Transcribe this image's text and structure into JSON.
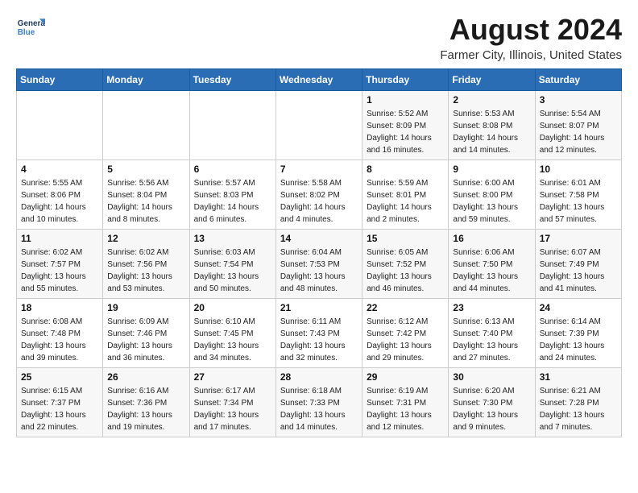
{
  "logo": {
    "line1": "General",
    "line2": "Blue"
  },
  "title": "August 2024",
  "location": "Farmer City, Illinois, United States",
  "days_of_week": [
    "Sunday",
    "Monday",
    "Tuesday",
    "Wednesday",
    "Thursday",
    "Friday",
    "Saturday"
  ],
  "weeks": [
    [
      {
        "day": "",
        "info": ""
      },
      {
        "day": "",
        "info": ""
      },
      {
        "day": "",
        "info": ""
      },
      {
        "day": "",
        "info": ""
      },
      {
        "day": "1",
        "info": "Sunrise: 5:52 AM\nSunset: 8:09 PM\nDaylight: 14 hours\nand 16 minutes."
      },
      {
        "day": "2",
        "info": "Sunrise: 5:53 AM\nSunset: 8:08 PM\nDaylight: 14 hours\nand 14 minutes."
      },
      {
        "day": "3",
        "info": "Sunrise: 5:54 AM\nSunset: 8:07 PM\nDaylight: 14 hours\nand 12 minutes."
      }
    ],
    [
      {
        "day": "4",
        "info": "Sunrise: 5:55 AM\nSunset: 8:06 PM\nDaylight: 14 hours\nand 10 minutes."
      },
      {
        "day": "5",
        "info": "Sunrise: 5:56 AM\nSunset: 8:04 PM\nDaylight: 14 hours\nand 8 minutes."
      },
      {
        "day": "6",
        "info": "Sunrise: 5:57 AM\nSunset: 8:03 PM\nDaylight: 14 hours\nand 6 minutes."
      },
      {
        "day": "7",
        "info": "Sunrise: 5:58 AM\nSunset: 8:02 PM\nDaylight: 14 hours\nand 4 minutes."
      },
      {
        "day": "8",
        "info": "Sunrise: 5:59 AM\nSunset: 8:01 PM\nDaylight: 14 hours\nand 2 minutes."
      },
      {
        "day": "9",
        "info": "Sunrise: 6:00 AM\nSunset: 8:00 PM\nDaylight: 13 hours\nand 59 minutes."
      },
      {
        "day": "10",
        "info": "Sunrise: 6:01 AM\nSunset: 7:58 PM\nDaylight: 13 hours\nand 57 minutes."
      }
    ],
    [
      {
        "day": "11",
        "info": "Sunrise: 6:02 AM\nSunset: 7:57 PM\nDaylight: 13 hours\nand 55 minutes."
      },
      {
        "day": "12",
        "info": "Sunrise: 6:02 AM\nSunset: 7:56 PM\nDaylight: 13 hours\nand 53 minutes."
      },
      {
        "day": "13",
        "info": "Sunrise: 6:03 AM\nSunset: 7:54 PM\nDaylight: 13 hours\nand 50 minutes."
      },
      {
        "day": "14",
        "info": "Sunrise: 6:04 AM\nSunset: 7:53 PM\nDaylight: 13 hours\nand 48 minutes."
      },
      {
        "day": "15",
        "info": "Sunrise: 6:05 AM\nSunset: 7:52 PM\nDaylight: 13 hours\nand 46 minutes."
      },
      {
        "day": "16",
        "info": "Sunrise: 6:06 AM\nSunset: 7:50 PM\nDaylight: 13 hours\nand 44 minutes."
      },
      {
        "day": "17",
        "info": "Sunrise: 6:07 AM\nSunset: 7:49 PM\nDaylight: 13 hours\nand 41 minutes."
      }
    ],
    [
      {
        "day": "18",
        "info": "Sunrise: 6:08 AM\nSunset: 7:48 PM\nDaylight: 13 hours\nand 39 minutes."
      },
      {
        "day": "19",
        "info": "Sunrise: 6:09 AM\nSunset: 7:46 PM\nDaylight: 13 hours\nand 36 minutes."
      },
      {
        "day": "20",
        "info": "Sunrise: 6:10 AM\nSunset: 7:45 PM\nDaylight: 13 hours\nand 34 minutes."
      },
      {
        "day": "21",
        "info": "Sunrise: 6:11 AM\nSunset: 7:43 PM\nDaylight: 13 hours\nand 32 minutes."
      },
      {
        "day": "22",
        "info": "Sunrise: 6:12 AM\nSunset: 7:42 PM\nDaylight: 13 hours\nand 29 minutes."
      },
      {
        "day": "23",
        "info": "Sunrise: 6:13 AM\nSunset: 7:40 PM\nDaylight: 13 hours\nand 27 minutes."
      },
      {
        "day": "24",
        "info": "Sunrise: 6:14 AM\nSunset: 7:39 PM\nDaylight: 13 hours\nand 24 minutes."
      }
    ],
    [
      {
        "day": "25",
        "info": "Sunrise: 6:15 AM\nSunset: 7:37 PM\nDaylight: 13 hours\nand 22 minutes."
      },
      {
        "day": "26",
        "info": "Sunrise: 6:16 AM\nSunset: 7:36 PM\nDaylight: 13 hours\nand 19 minutes."
      },
      {
        "day": "27",
        "info": "Sunrise: 6:17 AM\nSunset: 7:34 PM\nDaylight: 13 hours\nand 17 minutes."
      },
      {
        "day": "28",
        "info": "Sunrise: 6:18 AM\nSunset: 7:33 PM\nDaylight: 13 hours\nand 14 minutes."
      },
      {
        "day": "29",
        "info": "Sunrise: 6:19 AM\nSunset: 7:31 PM\nDaylight: 13 hours\nand 12 minutes."
      },
      {
        "day": "30",
        "info": "Sunrise: 6:20 AM\nSunset: 7:30 PM\nDaylight: 13 hours\nand 9 minutes."
      },
      {
        "day": "31",
        "info": "Sunrise: 6:21 AM\nSunset: 7:28 PM\nDaylight: 13 hours\nand 7 minutes."
      }
    ]
  ]
}
